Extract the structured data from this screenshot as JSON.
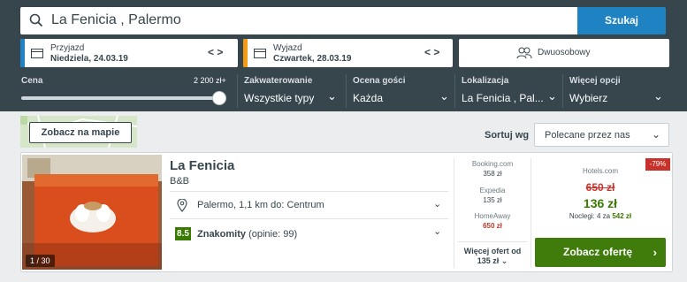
{
  "search": {
    "value": "La Fenicia , Palermo",
    "button": "Szukaj"
  },
  "dates": {
    "checkin": {
      "label": "Przyjazd",
      "value": "Niedziela, 24.03.19",
      "arrows": "< >"
    },
    "checkout": {
      "label": "Wyjazd",
      "value": "Czwartek, 28.03.19",
      "arrows": "< >"
    },
    "room": "Dwuosobowy"
  },
  "filters": {
    "price_label": "Cena",
    "price_max": "2 200 zł+",
    "price_fill": 1.0,
    "items": [
      {
        "label": "Zakwaterowanie",
        "value": "Wszystkie typy"
      },
      {
        "label": "Ocena gości",
        "value": "Każda"
      },
      {
        "label": "Lokalizacja",
        "value": "La Fenicia , Pal..."
      },
      {
        "label": "Więcej opcji",
        "value": "Wybierz"
      }
    ]
  },
  "toolbar": {
    "map_button": "Zobacz na mapie",
    "sort_label": "Sortuj wg",
    "sort_value": "Polecane przez nas"
  },
  "hotel": {
    "name": "La Fenicia",
    "type": "B&B",
    "photo_count": "1 / 30",
    "location": "Palermo, 1,1 km do: Centrum",
    "rating_score": "8.5",
    "rating_word": "Znakomity",
    "rating_reviews": "(opinie: 99)",
    "deals": [
      {
        "site": "Booking.com",
        "price": "358 zł"
      },
      {
        "site": "Expedia",
        "price": "135 zł"
      },
      {
        "site": "HomeAway",
        "price": "650 zł"
      }
    ],
    "more_label": "Więcej ofert od",
    "more_price": "135 zł",
    "discount": "-79%",
    "best_site": "Hotels.com",
    "old_price": "650 zł",
    "new_price": "136 zł",
    "nights_text": "Noclegi: 4 za",
    "nights_total": "542 zł",
    "cta": "Zobacz ofertę"
  },
  "colors": {
    "header": "#37454d",
    "accent_blue": "#1e82c3",
    "green": "#3f7c0b",
    "red": "#c9322b",
    "checkin_bar": "#1e82c3",
    "checkout_bar": "#f39c12"
  }
}
